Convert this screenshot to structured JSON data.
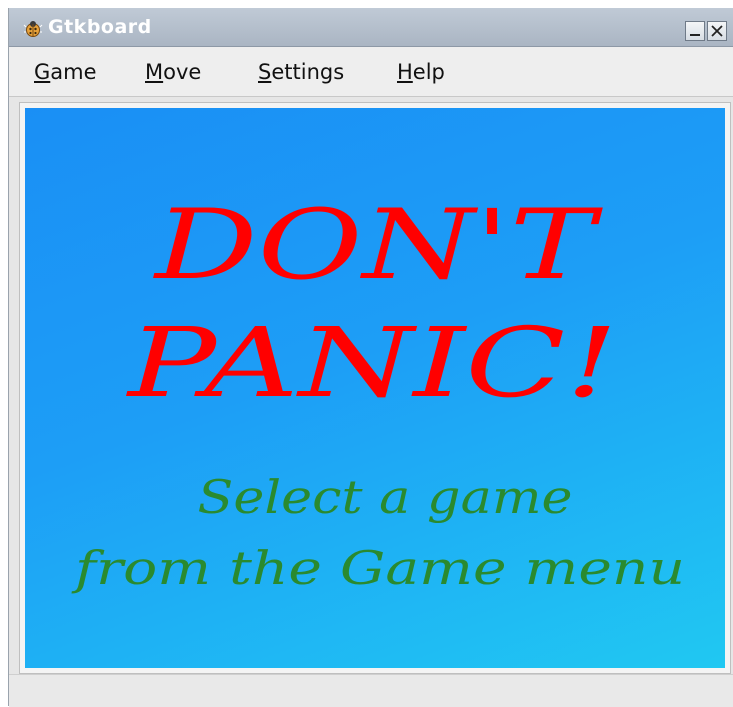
{
  "window": {
    "title": "Gtkboard",
    "icon": "ladybug-icon",
    "controls": [
      "minimize-icon",
      "close-icon"
    ]
  },
  "menubar": {
    "items": [
      {
        "mnemonic": "G",
        "rest": "ame"
      },
      {
        "mnemonic": "M",
        "rest": "ove"
      },
      {
        "mnemonic": "S",
        "rest": "ettings"
      },
      {
        "mnemonic": "H",
        "rest": "elp"
      }
    ]
  },
  "board": {
    "headline_line1": "DON'T",
    "headline_line2": "PANIC!",
    "sub_line1": "Select a game",
    "sub_line2": "from the Game menu",
    "colors": {
      "headline": "#ff0000",
      "subtext": "#2a8a2f",
      "background_start": "#1a8ff5",
      "background_end": "#20c8f2"
    }
  },
  "statusbar": {
    "text": ""
  }
}
